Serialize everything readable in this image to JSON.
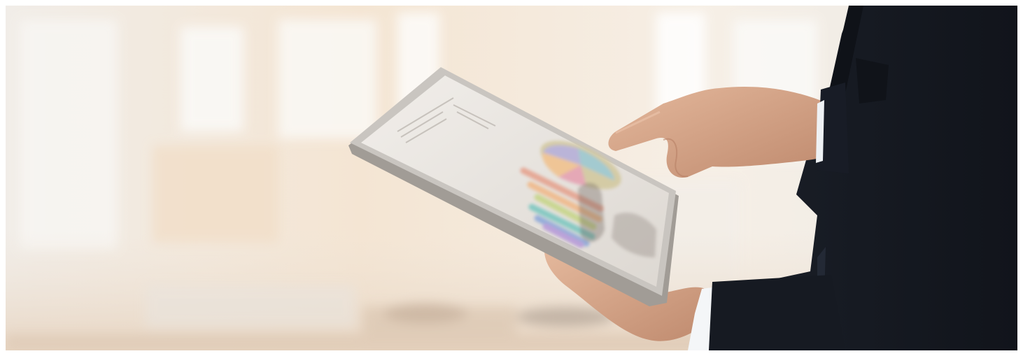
{
  "photo": {
    "subject": "businessman-using-tablet",
    "colors": {
      "background_warm": "#f4e6d4",
      "background_light": "#f7f5f1",
      "suit": "#181c26",
      "shirt": "#f4f6f8",
      "skin": "#d9a98d",
      "tablet_frame": "#b9b6b2",
      "screen": "#eae7e2"
    },
    "chart_bar_colors": [
      "#e5a38f",
      "#f0b98a",
      "#c7d58a",
      "#7ec8c1",
      "#8ea9d9",
      "#b79bd9"
    ],
    "pie_colors": [
      "#f0c28f",
      "#d3c9a0",
      "#9cc8cf",
      "#b6b0d8",
      "#e5a2b2"
    ]
  }
}
